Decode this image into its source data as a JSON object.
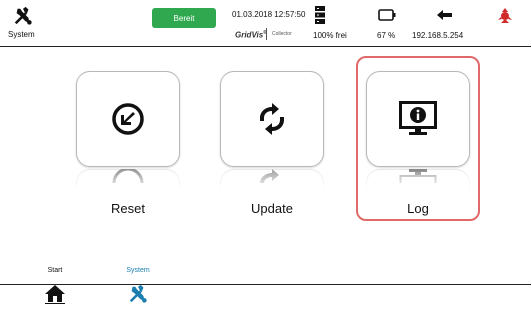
{
  "topbar": {
    "system_label": "System",
    "status": "Bereit",
    "status_color": "#2fa84f",
    "datetime": "01.03.2018 12:57:50",
    "brand": "GridVis",
    "brand_sub": "Collector",
    "memory": "100% frei",
    "battery": "67 %",
    "ip": "192.168.5.254"
  },
  "tiles": [
    {
      "label": "Reset",
      "icon": "reset-icon"
    },
    {
      "label": "Update",
      "icon": "update-icon"
    },
    {
      "label": "Log",
      "icon": "info-monitor-icon"
    }
  ],
  "nav": {
    "start_label": "Start",
    "system_label": "System",
    "active_color": "#1b7db0"
  },
  "colors": {
    "highlight": "#e06a6a"
  }
}
